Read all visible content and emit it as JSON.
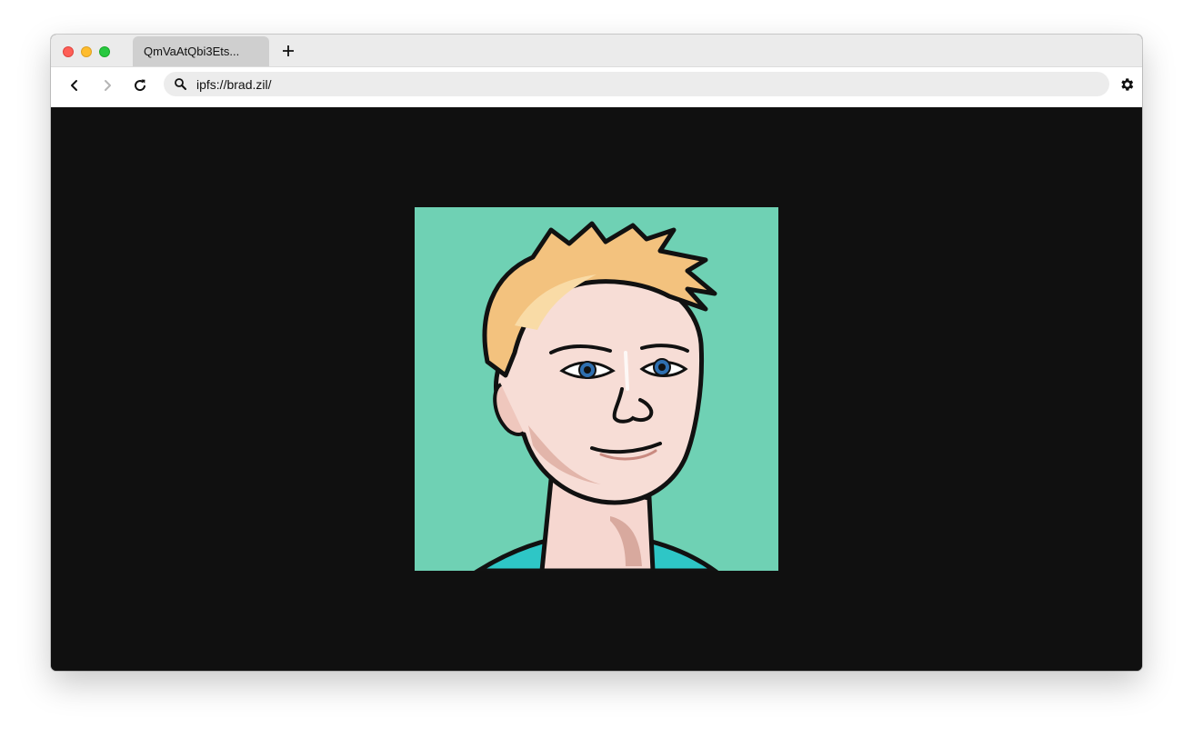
{
  "window": {
    "tab": {
      "title": "QmVaAtQbi3Ets..."
    },
    "new_tab_icon": "plus-icon"
  },
  "toolbar": {
    "back_icon": "chevron-left-icon",
    "forward_icon": "chevron-right-icon",
    "reload_icon": "reload-icon",
    "search_icon": "search-icon",
    "url": "ipfs://brad.zil/",
    "settings_icon": "gear-icon"
  },
  "content": {
    "background": "#101010",
    "image": {
      "subject": "cartoon portrait avatar",
      "background_color": "#6fd1b4"
    }
  },
  "colors": {
    "close": "#fe5f57",
    "minimize": "#febc2e",
    "zoom": "#28c840",
    "tabbar": "#ebebeb",
    "active_tab": "#cfcfcf",
    "urlbar": "#ececec"
  }
}
